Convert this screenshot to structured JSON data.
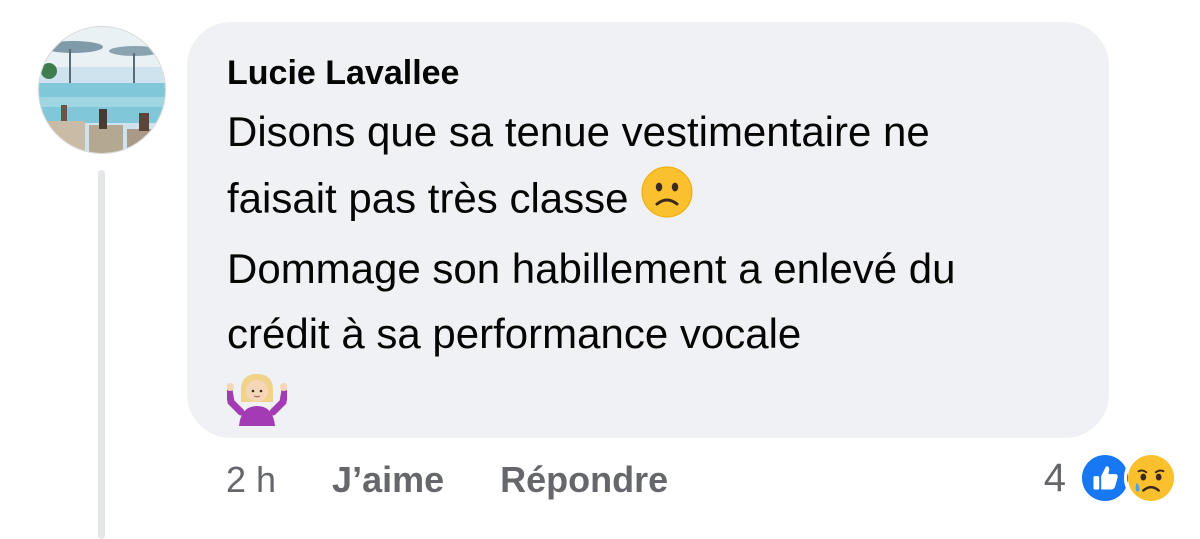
{
  "comment": {
    "author": "Lucie Lavallee",
    "lines": [
      "Disons que sa tenue vestimentaire ne",
      "faisait pas très classe",
      "Dommage son habillement a enlevé du",
      "crédit à sa performance vocale"
    ],
    "emoji_after_line_2": "slightly-frowning-face",
    "final_emoji": "woman-shrugging"
  },
  "actions": {
    "time": "2 h",
    "like_label": "J’aime",
    "reply_label": "Répondre"
  },
  "reactions": {
    "count": "4",
    "icons": [
      "like-icon",
      "sad-icon"
    ]
  },
  "colors": {
    "bubble": "#f0f1f4",
    "text": "#050505",
    "secondary_text": "#65676b",
    "like_blue": "#1877f2",
    "emoji_yellow": "#fbc02d"
  }
}
